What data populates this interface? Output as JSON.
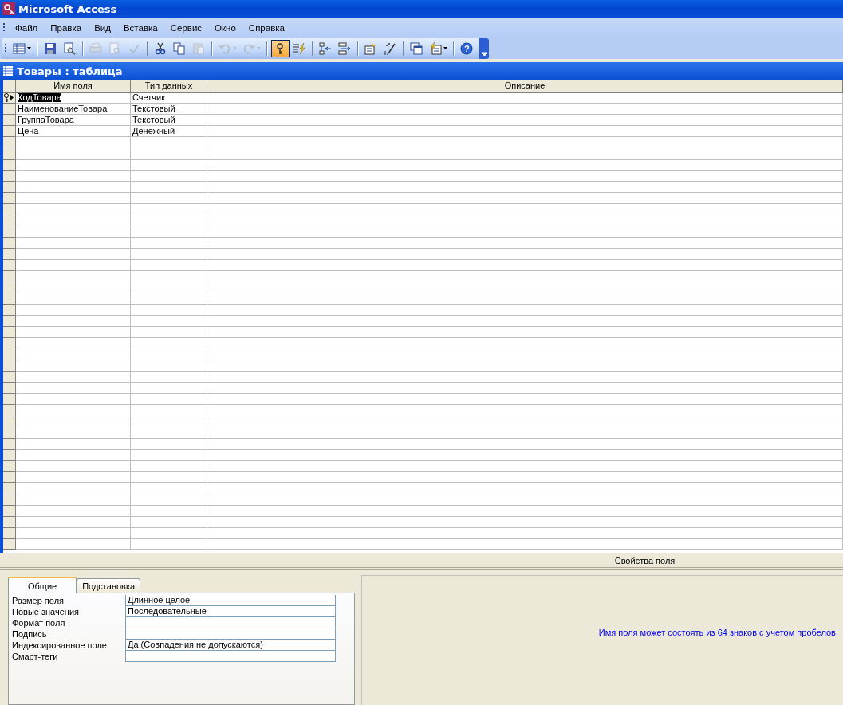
{
  "window": {
    "title": "Microsoft Access"
  },
  "menu": [
    "Файл",
    "Правка",
    "Вид",
    "Вставка",
    "Сервис",
    "Окно",
    "Справка"
  ],
  "toolbar": [
    {
      "kind": "view",
      "disabled": false,
      "pressed": false,
      "dropdown": true
    },
    {
      "kind": "separator"
    },
    {
      "kind": "save",
      "disabled": false,
      "pressed": false,
      "dropdown": false
    },
    {
      "kind": "search",
      "disabled": false,
      "pressed": false,
      "dropdown": false
    },
    {
      "kind": "separator"
    },
    {
      "kind": "print",
      "disabled": true,
      "pressed": false,
      "dropdown": false
    },
    {
      "kind": "preview",
      "disabled": true,
      "pressed": false,
      "dropdown": false
    },
    {
      "kind": "spelling",
      "disabled": true,
      "pressed": false,
      "dropdown": false
    },
    {
      "kind": "separator"
    },
    {
      "kind": "cut",
      "disabled": false,
      "pressed": false,
      "dropdown": false
    },
    {
      "kind": "copy",
      "disabled": false,
      "pressed": false,
      "dropdown": false
    },
    {
      "kind": "paste",
      "disabled": true,
      "pressed": false,
      "dropdown": false
    },
    {
      "kind": "separator"
    },
    {
      "kind": "undo",
      "disabled": true,
      "pressed": false,
      "dropdown": true
    },
    {
      "kind": "redo",
      "disabled": true,
      "pressed": false,
      "dropdown": true
    },
    {
      "kind": "separator"
    },
    {
      "kind": "key",
      "disabled": false,
      "pressed": true,
      "dropdown": false
    },
    {
      "kind": "lightning",
      "disabled": false,
      "pressed": false,
      "dropdown": false
    },
    {
      "kind": "separator"
    },
    {
      "kind": "insert-rows",
      "disabled": false,
      "pressed": false,
      "dropdown": false
    },
    {
      "kind": "delete-rows",
      "disabled": false,
      "pressed": false,
      "dropdown": false
    },
    {
      "kind": "separator"
    },
    {
      "kind": "properties",
      "disabled": false,
      "pressed": false,
      "dropdown": false
    },
    {
      "kind": "build",
      "disabled": false,
      "pressed": false,
      "dropdown": false
    },
    {
      "kind": "separator"
    },
    {
      "kind": "windows",
      "disabled": false,
      "pressed": false,
      "dropdown": false
    },
    {
      "kind": "new-object",
      "disabled": false,
      "pressed": false,
      "dropdown": true
    },
    {
      "kind": "separator"
    },
    {
      "kind": "help",
      "disabled": false,
      "pressed": false,
      "dropdown": false,
      "glyph": "?"
    }
  ],
  "document": {
    "title": "Товары : таблица"
  },
  "table": {
    "columns": [
      "Имя поля",
      "Тип данных",
      "Описание"
    ],
    "rows": [
      {
        "name": "КодТовара",
        "type": "Счетчик",
        "primary_key": true,
        "selected": true
      },
      {
        "name": "НаименованиеТовара",
        "type": "Текстовый",
        "primary_key": false,
        "selected": false
      },
      {
        "name": "ГруппаТовара",
        "type": "Текстовый",
        "primary_key": false,
        "selected": false
      },
      {
        "name": "Цена",
        "type": "Денежный",
        "primary_key": false,
        "selected": false
      }
    ]
  },
  "properties": {
    "title": "Свойства поля",
    "tabs": [
      {
        "label": "Общие",
        "selected": true
      },
      {
        "label": "Подстановка",
        "selected": false
      }
    ],
    "rows": [
      {
        "label": "Размер поля",
        "value": "Длинное целое"
      },
      {
        "label": "Новые значения",
        "value": "Последовательные"
      },
      {
        "label": "Формат поля"
      },
      {
        "label": "Подпись"
      },
      {
        "label": "Индексированное поле",
        "value": "Да (Совпадения не допускаются)"
      },
      {
        "label": "Смарт-теги"
      }
    ],
    "hint": "Имя поля может состоять из 64 знаков с учетом пробелов."
  }
}
